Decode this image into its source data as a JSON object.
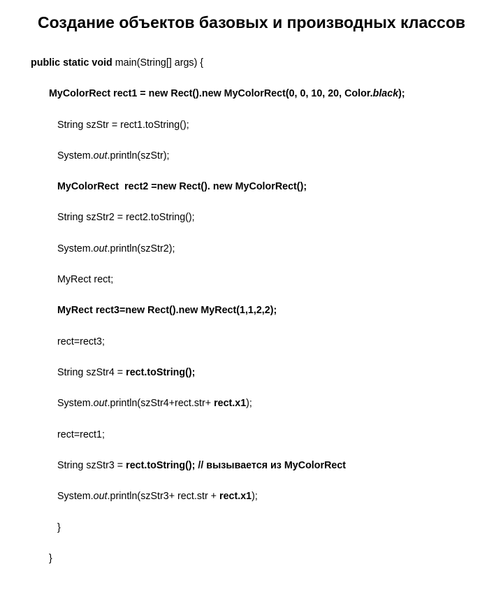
{
  "title": "Создание объектов базовых и производных классов",
  "line1_sig_b": "public static void",
  "line1_sig_r": " main(String[] args) {",
  "line2": "MyColorRect rect1 = new Rect().new MyColorRect(0, 0, 10, 20, Color.",
  "line2_bi": "black",
  "line2_b2": ");",
  "line3": "String szStr = rect1.toString();",
  "line4a": "System.",
  "line4i": "out",
  "line4b": ".println(szStr);",
  "line5": "MyColorRect  rect2 =new Rect(). new MyColorRect();",
  "line6": "String szStr2 = rect2.toString();",
  "line7a": "System.",
  "line7i": "out",
  "line7b": ".println(szStr2);",
  "line8": "MyRect rect;",
  "line9": "MyRect rect3=new Rect().new MyRect(1,1,2,2);",
  "line10": "rect=rect3;",
  "line11a": "String szStr4 = ",
  "line11b": "rect.toString();",
  "line12a": "System.",
  "line12i": "out",
  "line12b": ".println(szStr4+rect.str+",
  "line12c": " rect.x1",
  "line12d": ");",
  "line13": "rect=rect1;",
  "line14a": "String szStr3 = ",
  "line14b": "rect.toString(); // вызывается из MyColorRect",
  "line15a": "System.",
  "line15i": "out",
  "line15b": ".println(szStr3+ rect.str + ",
  "line15c": "rect.x1",
  "line15d": ");",
  "brace1": "}",
  "brace2": "}"
}
